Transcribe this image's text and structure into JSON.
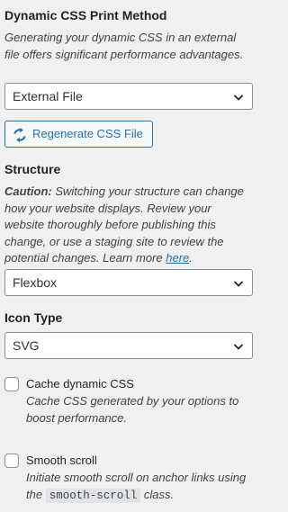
{
  "print_method": {
    "title": "Dynamic CSS Print Method",
    "description": "Generating your dynamic CSS in an external file offers significant performance advantages.",
    "selected": "External File",
    "regenerate_label": "Regenerate CSS File"
  },
  "structure": {
    "title": "Structure",
    "caution_label": "Caution:",
    "caution_text": " Switching your structure can change how your website displays. Review your website thoroughly before publishing this change, or use a staging site to review the potential changes. Learn more ",
    "link_text": "here",
    "after_link": ".",
    "selected": "Flexbox"
  },
  "icon_type": {
    "title": "Icon Type",
    "selected": "SVG"
  },
  "cache": {
    "label": "Cache dynamic CSS",
    "description": "Cache CSS generated by your options to boost performance.",
    "checked": false
  },
  "smooth_scroll": {
    "label": "Smooth scroll",
    "desc_before": "Initiate smooth scroll on anchor links using the ",
    "code": "smooth-scroll",
    "desc_after": " class.",
    "checked": false
  },
  "colors": {
    "accent": "#2271b1",
    "text": "#1d2327",
    "muted": "#3c434a",
    "border": "#8c8f94",
    "background": "#f0f0f1"
  },
  "icons": {
    "select_arrow": "chevron-down-icon",
    "regenerate": "refresh-icon"
  }
}
